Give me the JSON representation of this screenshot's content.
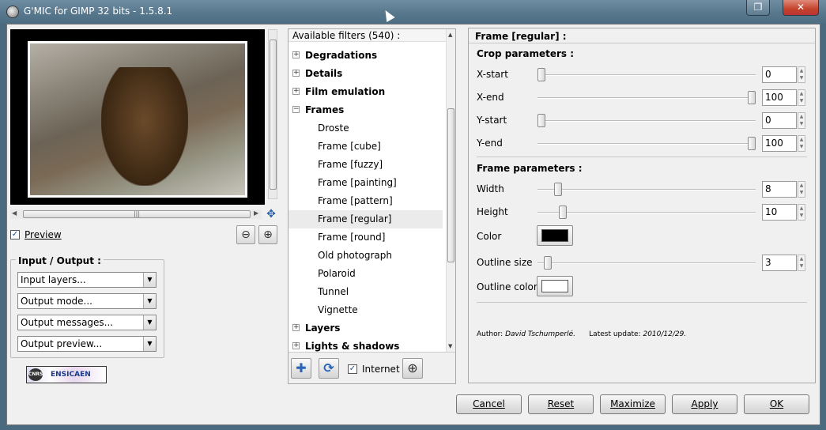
{
  "window": {
    "title": "G'MIC for GIMP 32 bits - 1.5.8.1"
  },
  "preview": {
    "label": "Preview",
    "checked": true
  },
  "io": {
    "title": "Input / Output :",
    "combos": [
      "Input layers...",
      "Output mode...",
      "Output messages...",
      "Output preview..."
    ]
  },
  "logo": {
    "text": "ENSICAEN",
    "badge": "CNRS"
  },
  "filters": {
    "header": "Available filters (540) :",
    "items": [
      {
        "label": "Degradations",
        "kind": "cat",
        "exp": "+"
      },
      {
        "label": "Details",
        "kind": "cat",
        "exp": "+"
      },
      {
        "label": "Film emulation",
        "kind": "cat",
        "exp": "+"
      },
      {
        "label": "Frames",
        "kind": "cat",
        "exp": "−"
      },
      {
        "label": "Droste",
        "kind": "sub"
      },
      {
        "label": "Frame [cube]",
        "kind": "sub"
      },
      {
        "label": "Frame [fuzzy]",
        "kind": "sub"
      },
      {
        "label": "Frame [painting]",
        "kind": "sub"
      },
      {
        "label": "Frame [pattern]",
        "kind": "sub"
      },
      {
        "label": "Frame [regular]",
        "kind": "sub",
        "selected": true
      },
      {
        "label": "Frame [round]",
        "kind": "sub"
      },
      {
        "label": "Old photograph",
        "kind": "sub"
      },
      {
        "label": "Polaroid",
        "kind": "sub"
      },
      {
        "label": "Tunnel",
        "kind": "sub"
      },
      {
        "label": "Vignette",
        "kind": "sub"
      },
      {
        "label": "Layers",
        "kind": "cat",
        "exp": "+"
      },
      {
        "label": "Lights & shadows",
        "kind": "cat",
        "exp": "+"
      }
    ],
    "internet_label": "Internet",
    "internet_checked": true
  },
  "params": {
    "title": "Frame [regular] :",
    "crop_section": "Crop parameters :",
    "frame_section": "Frame parameters :",
    "sliders": [
      {
        "key": "x_start",
        "label": "X-start",
        "value": "0",
        "fraction": 0.0
      },
      {
        "key": "x_end",
        "label": "X-end",
        "value": "100",
        "fraction": 1.0
      },
      {
        "key": "y_start",
        "label": "Y-start",
        "value": "0",
        "fraction": 0.0
      },
      {
        "key": "y_end",
        "label": "Y-end",
        "value": "100",
        "fraction": 1.0
      },
      {
        "key": "width",
        "label": "Width",
        "value": "8",
        "fraction": 0.08
      },
      {
        "key": "height",
        "label": "Height",
        "value": "10",
        "fraction": 0.1
      },
      {
        "key": "outline_size",
        "label": "Outline size",
        "value": "3",
        "fraction": 0.03
      }
    ],
    "color_label": "Color",
    "color_value": "#000000",
    "outline_color_label": "Outline color",
    "outline_color_value": "#ffffff",
    "author_prefix": "Author:",
    "author_name": "David Tschumperlé.",
    "update_prefix": "Latest update:",
    "update_date": "2010/12/29."
  },
  "buttons": {
    "cancel": "Cancel",
    "reset": "Reset",
    "maximize": "Maximize",
    "apply": "Apply",
    "ok": "OK"
  }
}
